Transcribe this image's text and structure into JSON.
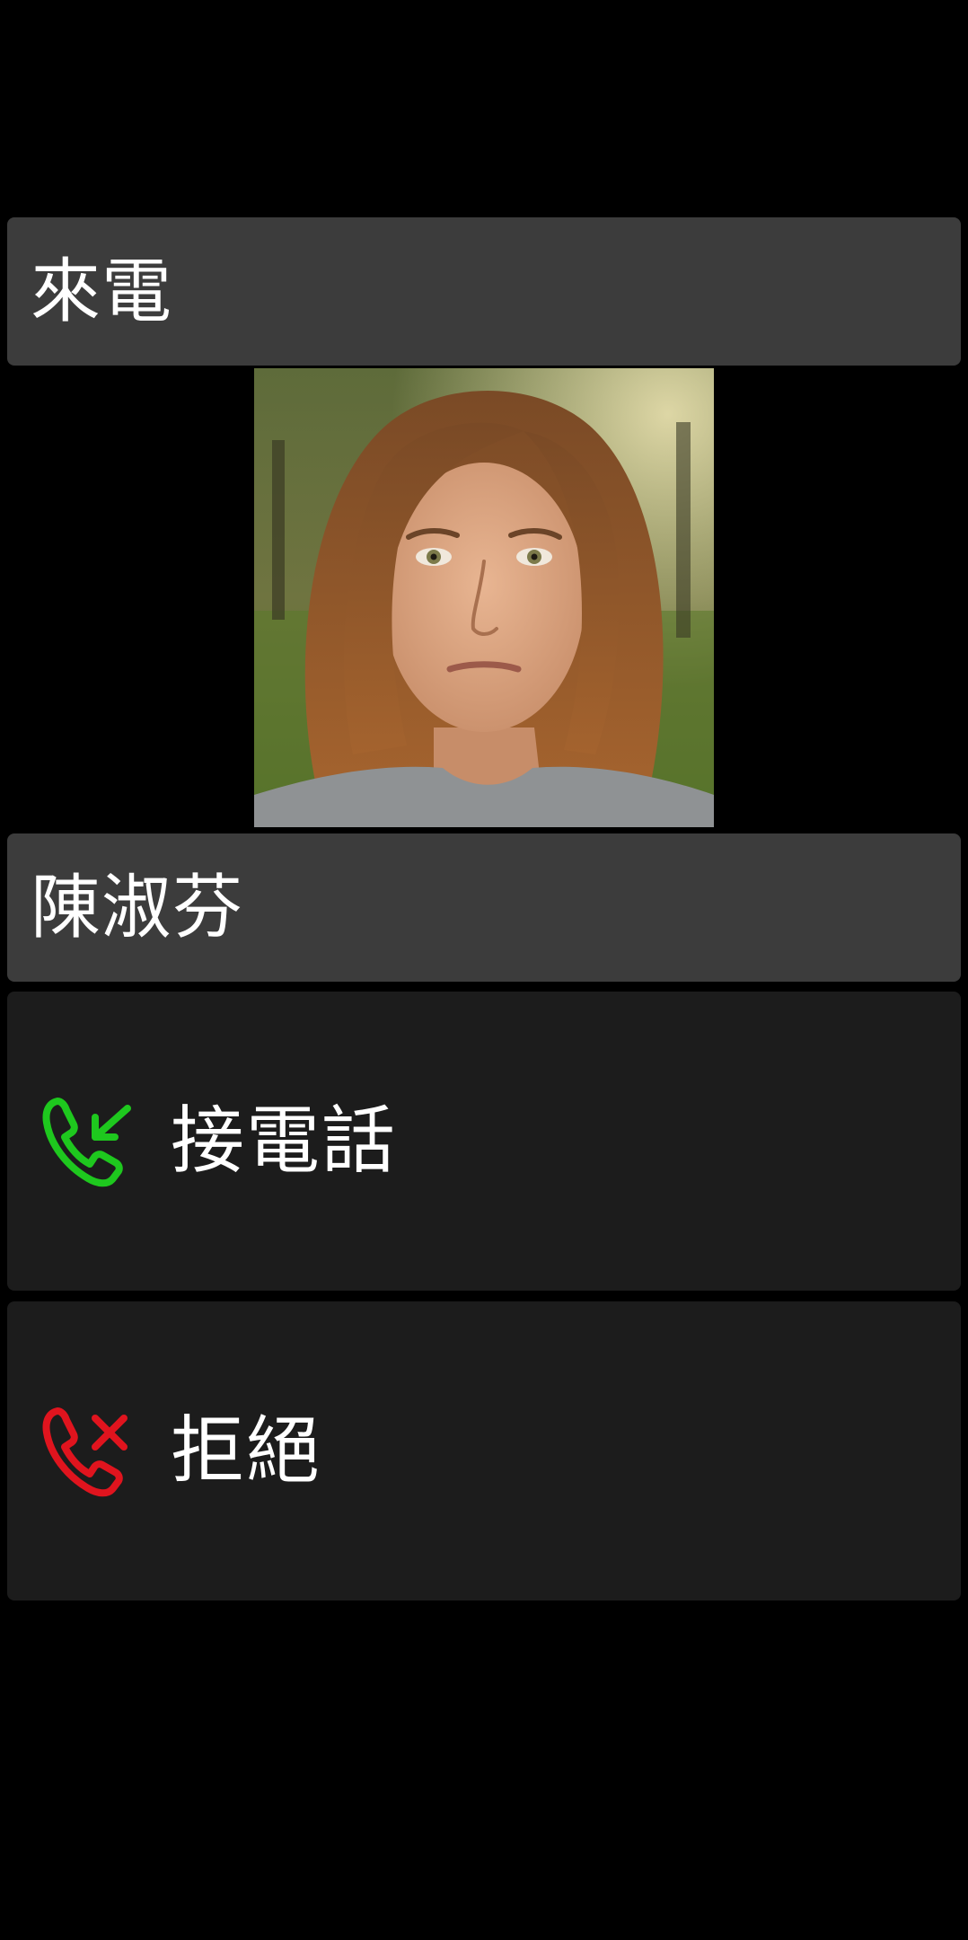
{
  "header": {
    "title": "來電"
  },
  "caller": {
    "name": "陳淑芬",
    "photo_icon": "caller-photo"
  },
  "actions": {
    "answer": {
      "label": "接電話",
      "icon": "phone-incoming-icon",
      "color": "#1ec81e"
    },
    "decline": {
      "label": "拒絕",
      "icon": "phone-decline-icon",
      "color": "#e0141e"
    }
  },
  "colors": {
    "background": "#000000",
    "bar": "#3c3c3c",
    "button": "#1c1c1c",
    "text": "#ffffff"
  }
}
